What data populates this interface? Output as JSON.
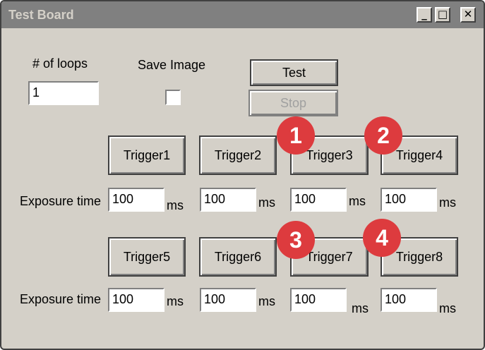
{
  "window": {
    "title": "Test Board",
    "controls": {
      "minimize": "_",
      "maximize": "□",
      "close": "✕"
    }
  },
  "loops": {
    "label": "# of loops",
    "value": "1"
  },
  "save_image": {
    "label": "Save Image",
    "checked": false
  },
  "actions": {
    "test_label": "Test",
    "stop_label": "Stop"
  },
  "rows": [
    {
      "exposure_label": "Exposure time",
      "unit": "ms",
      "triggers": [
        {
          "label": "Trigger1",
          "exposure": "100"
        },
        {
          "label": "Trigger2",
          "exposure": "100"
        },
        {
          "label": "Trigger3",
          "exposure": "100"
        },
        {
          "label": "Trigger4",
          "exposure": "100"
        }
      ]
    },
    {
      "exposure_label": "Exposure time",
      "unit": "ms",
      "triggers": [
        {
          "label": "Trigger5",
          "exposure": "100"
        },
        {
          "label": "Trigger6",
          "exposure": "100"
        },
        {
          "label": "Trigger7",
          "exposure": "100"
        },
        {
          "label": "Trigger8",
          "exposure": "100"
        }
      ]
    }
  ],
  "annotations": [
    "1",
    "2",
    "3",
    "4"
  ],
  "colors": {
    "badge": "#dd3b3e",
    "window_bg": "#d4d0c8",
    "titlebar": "#808080"
  }
}
